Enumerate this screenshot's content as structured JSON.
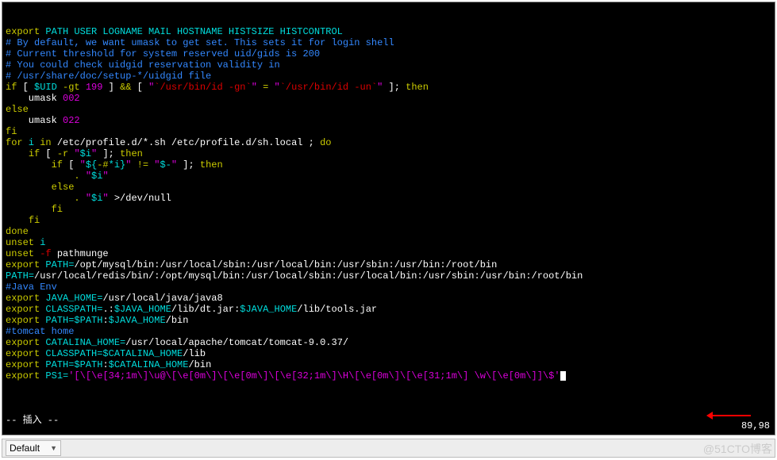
{
  "terminal_lines": [
    [
      {
        "c": "y",
        "t": "export"
      },
      {
        "c": "c",
        "t": " PATH USER LOGNAME MAIL HOSTNAME HISTSIZE HISTCONTROL"
      }
    ],
    [
      {
        "c": "w",
        "t": ""
      }
    ],
    [
      {
        "c": "b",
        "t": "# By default, we want umask to get set. This sets it for login shell"
      }
    ],
    [
      {
        "c": "b",
        "t": "# Current threshold for system reserved uid/gids is 200"
      }
    ],
    [
      {
        "c": "b",
        "t": "# You could check uidgid reservation validity in"
      }
    ],
    [
      {
        "c": "b",
        "t": "# /usr/share/doc/setup-*/uidgid file"
      }
    ],
    [
      {
        "c": "y",
        "t": "if"
      },
      {
        "c": "w",
        "t": " [ "
      },
      {
        "c": "c",
        "t": "$UID"
      },
      {
        "c": "y",
        "t": " -gt"
      },
      {
        "c": "w",
        "t": " "
      },
      {
        "c": "m",
        "t": "199"
      },
      {
        "c": "w",
        "t": " ] "
      },
      {
        "c": "y",
        "t": "&&"
      },
      {
        "c": "w",
        "t": " [ "
      },
      {
        "c": "m",
        "t": "\""
      },
      {
        "c": "r",
        "t": "`/usr/bin/id -gn`"
      },
      {
        "c": "m",
        "t": "\""
      },
      {
        "c": "y",
        "t": " = "
      },
      {
        "c": "m",
        "t": "\""
      },
      {
        "c": "r",
        "t": "`/usr/bin/id -un`"
      },
      {
        "c": "m",
        "t": "\""
      },
      {
        "c": "w",
        "t": " ]; "
      },
      {
        "c": "y",
        "t": "then"
      }
    ],
    [
      {
        "c": "w",
        "t": "    umask "
      },
      {
        "c": "m",
        "t": "002"
      }
    ],
    [
      {
        "c": "y",
        "t": "else"
      }
    ],
    [
      {
        "c": "w",
        "t": "    umask "
      },
      {
        "c": "m",
        "t": "022"
      }
    ],
    [
      {
        "c": "y",
        "t": "fi"
      }
    ],
    [
      {
        "c": "w",
        "t": ""
      }
    ],
    [
      {
        "c": "y",
        "t": "for"
      },
      {
        "c": "c",
        "t": " i "
      },
      {
        "c": "y",
        "t": "in"
      },
      {
        "c": "w",
        "t": " /etc/profile.d/*.sh /etc/profile.d/sh.local ; "
      },
      {
        "c": "y",
        "t": "do"
      }
    ],
    [
      {
        "c": "w",
        "t": "    "
      },
      {
        "c": "y",
        "t": "if"
      },
      {
        "c": "w",
        "t": " [ "
      },
      {
        "c": "y",
        "t": "-r"
      },
      {
        "c": "w",
        "t": " "
      },
      {
        "c": "m",
        "t": "\""
      },
      {
        "c": "c",
        "t": "$i"
      },
      {
        "c": "m",
        "t": "\""
      },
      {
        "c": "w",
        "t": " ]; "
      },
      {
        "c": "y",
        "t": "then"
      }
    ],
    [
      {
        "c": "w",
        "t": "        "
      },
      {
        "c": "y",
        "t": "if"
      },
      {
        "c": "w",
        "t": " [ "
      },
      {
        "c": "m",
        "t": "\""
      },
      {
        "c": "c",
        "t": "${"
      },
      {
        "c": "y",
        "t": "-#"
      },
      {
        "c": "c",
        "t": "*i}"
      },
      {
        "c": "m",
        "t": "\""
      },
      {
        "c": "y",
        "t": " != "
      },
      {
        "c": "m",
        "t": "\""
      },
      {
        "c": "c",
        "t": "$-"
      },
      {
        "c": "m",
        "t": "\""
      },
      {
        "c": "w",
        "t": " ]; "
      },
      {
        "c": "y",
        "t": "then"
      }
    ],
    [
      {
        "c": "w",
        "t": "            "
      },
      {
        "c": "y",
        "t": "."
      },
      {
        "c": "w",
        "t": " "
      },
      {
        "c": "m",
        "t": "\""
      },
      {
        "c": "c",
        "t": "$i"
      },
      {
        "c": "m",
        "t": "\""
      }
    ],
    [
      {
        "c": "w",
        "t": "        "
      },
      {
        "c": "y",
        "t": "else"
      }
    ],
    [
      {
        "c": "w",
        "t": "            "
      },
      {
        "c": "y",
        "t": "."
      },
      {
        "c": "w",
        "t": " "
      },
      {
        "c": "m",
        "t": "\""
      },
      {
        "c": "c",
        "t": "$i"
      },
      {
        "c": "m",
        "t": "\""
      },
      {
        "c": "w",
        "t": " >/dev/null"
      }
    ],
    [
      {
        "c": "w",
        "t": "        "
      },
      {
        "c": "y",
        "t": "fi"
      }
    ],
    [
      {
        "c": "w",
        "t": "    "
      },
      {
        "c": "y",
        "t": "fi"
      }
    ],
    [
      {
        "c": "y",
        "t": "done"
      }
    ],
    [
      {
        "c": "w",
        "t": ""
      }
    ],
    [
      {
        "c": "y",
        "t": "unset"
      },
      {
        "c": "c",
        "t": " i"
      }
    ],
    [
      {
        "c": "y",
        "t": "unset"
      },
      {
        "c": "r",
        "t": " -f"
      },
      {
        "c": "w",
        "t": " pathmunge"
      }
    ],
    [
      {
        "c": "y",
        "t": "export"
      },
      {
        "c": "c",
        "t": " PATH="
      },
      {
        "c": "w",
        "t": "/opt/mysql/bin:/usr/local/sbin:/usr/local/bin:/usr/sbin:/usr/bin:/root/bin"
      }
    ],
    [
      {
        "c": "c",
        "t": "PATH="
      },
      {
        "c": "w",
        "t": "/usr/local/redis/bin/:/opt/mysql/bin:/usr/local/sbin:/usr/local/bin:/usr/sbin:/usr/bin:/root/bin"
      }
    ],
    [
      {
        "c": "w",
        "t": ""
      }
    ],
    [
      {
        "c": "b",
        "t": "#Java Env"
      }
    ],
    [
      {
        "c": "y",
        "t": "export"
      },
      {
        "c": "c",
        "t": " JAVA_HOME="
      },
      {
        "c": "w",
        "t": "/usr/local/java/java8"
      }
    ],
    [
      {
        "c": "y",
        "t": "export"
      },
      {
        "c": "c",
        "t": " CLASSPATH="
      },
      {
        "c": "w",
        "t": ".:"
      },
      {
        "c": "c",
        "t": "$JAVA_HOME"
      },
      {
        "c": "w",
        "t": "/lib/dt.jar:"
      },
      {
        "c": "c",
        "t": "$JAVA_HOME"
      },
      {
        "c": "w",
        "t": "/lib/tools.jar"
      }
    ],
    [
      {
        "c": "y",
        "t": "export"
      },
      {
        "c": "c",
        "t": " PATH=$PATH"
      },
      {
        "c": "w",
        "t": ":"
      },
      {
        "c": "c",
        "t": "$JAVA_HOME"
      },
      {
        "c": "w",
        "t": "/bin"
      }
    ],
    [
      {
        "c": "w",
        "t": ""
      }
    ],
    [
      {
        "c": "b",
        "t": "#tomcat home"
      }
    ],
    [
      {
        "c": "y",
        "t": "export"
      },
      {
        "c": "c",
        "t": " CATALINA_HOME="
      },
      {
        "c": "w",
        "t": "/usr/local/apache/tomcat/tomcat-9.0.37/"
      }
    ],
    [
      {
        "c": "y",
        "t": "export"
      },
      {
        "c": "c",
        "t": " CLASSPATH=$CATALINA_HOME"
      },
      {
        "c": "w",
        "t": "/lib"
      }
    ],
    [
      {
        "c": "y",
        "t": "export"
      },
      {
        "c": "c",
        "t": " PATH=$PATH"
      },
      {
        "c": "w",
        "t": ":"
      },
      {
        "c": "c",
        "t": "$CATALINA_HOME"
      },
      {
        "c": "w",
        "t": "/bin"
      }
    ],
    [
      {
        "c": "y",
        "t": "export"
      },
      {
        "c": "c",
        "t": " PS1="
      },
      {
        "c": "m",
        "t": "'[\\[\\e[34;1m\\]\\u@\\[\\e[0m\\]\\[\\e[0m\\]\\[\\e[32;1m\\]\\H\\[\\e[0m\\]\\[\\e[31;1m\\] \\w\\[\\e[0m\\]]\\$'"
      },
      {
        "c": "cursor",
        "t": ""
      }
    ]
  ],
  "mode_line": "-- 插入 --",
  "cursor_pos": "89,98",
  "footer_combo": "Default",
  "watermark": "@51CTO博客"
}
